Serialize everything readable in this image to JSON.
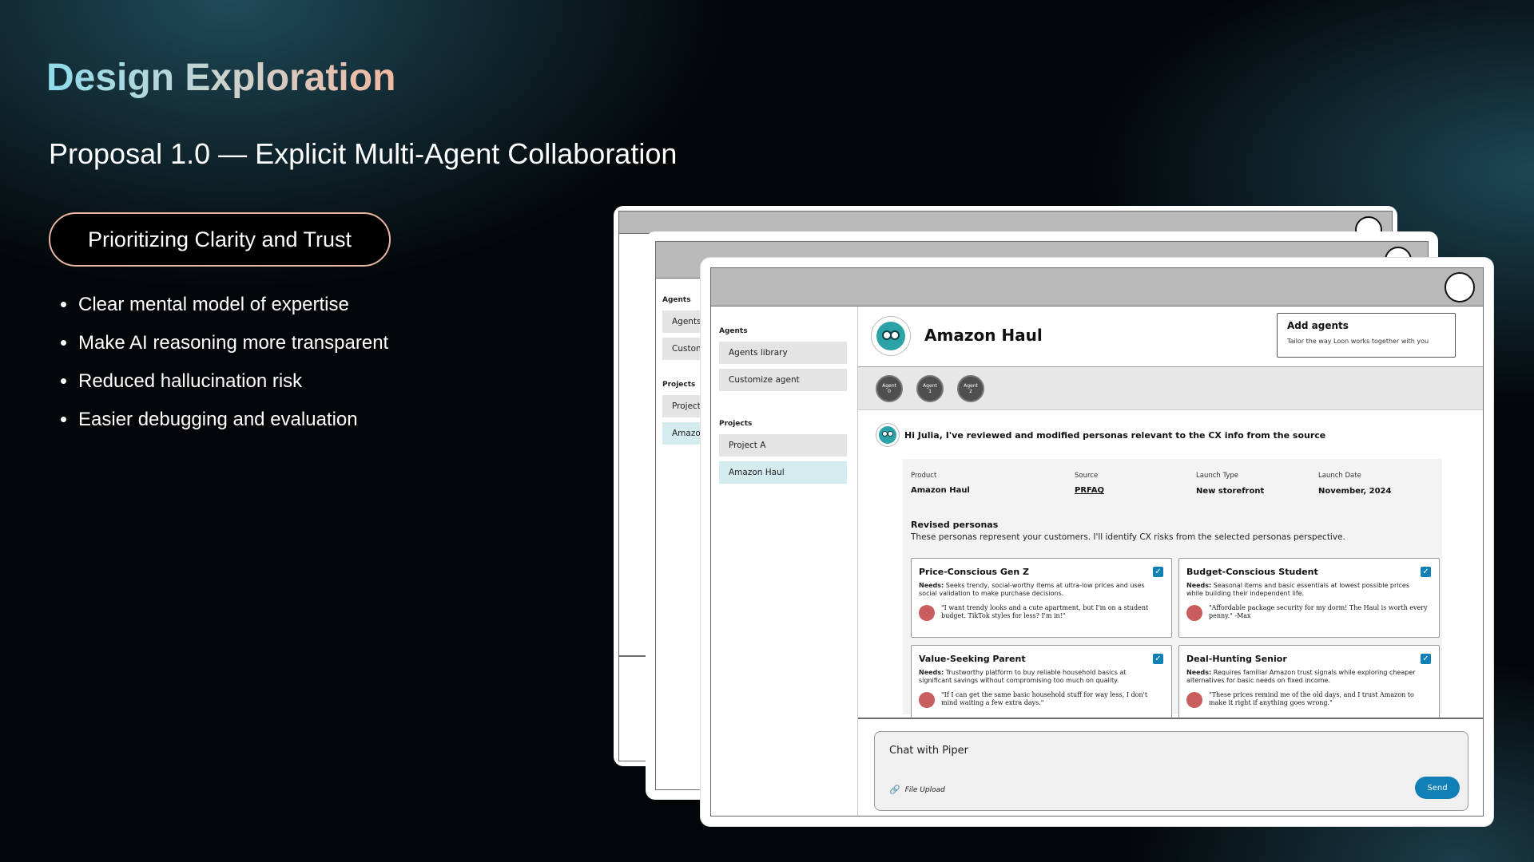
{
  "slide": {
    "title": "Design Exploration",
    "subtitle": "Proposal 1.0 — Explicit Multi-Agent Collaboration",
    "pill": "Prioritizing Clarity and Trust",
    "bullets": [
      "Clear mental model of expertise",
      "Make AI reasoning more transparent",
      "Reduced hallucination risk",
      "Easier debugging and evaluation"
    ],
    "colors": {
      "title_gradient": [
        "#8fdcec",
        "#f3b7a0"
      ],
      "pill_border": "#e7b6a3",
      "accent": "#0f7fb5"
    }
  },
  "back_card_1": {
    "sidebar": {
      "agents_heading": "Agents",
      "items": [
        "Agents",
        "Custon"
      ],
      "projects_heading": "Projects",
      "projects": [
        "Project",
        "Amazo"
      ]
    }
  },
  "mockup": {
    "sidebar": {
      "agents_heading": "Agents",
      "items": [
        "Agents library",
        "Customize agent"
      ],
      "projects_heading": "Projects",
      "projects": [
        "Project A",
        "Amazon Haul"
      ]
    },
    "header": {
      "title": "Amazon Haul",
      "add_agents_title": "Add agents",
      "add_agents_desc": "Tailor the way Loon works together with you"
    },
    "agents": [
      {
        "label": "Agent",
        "num": "0"
      },
      {
        "label": "Agent",
        "num": "1"
      },
      {
        "label": "Agent",
        "num": "2"
      }
    ],
    "message": "Hi Julia, I've reviewed and modified personas relevant to the CX info from the source",
    "meta": [
      {
        "key": "Product",
        "value": "Amazon Haul"
      },
      {
        "key": "Source",
        "value": "PRFAQ"
      },
      {
        "key": "Launch Type",
        "value": "New storefront"
      },
      {
        "key": "Launch Date",
        "value": "November, 2024"
      }
    ],
    "revised_title": "Revised personas",
    "revised_desc": "These personas represent your customers. I'll identify CX risks from the selected personas perspective.",
    "personas": [
      {
        "name": "Price-Conscious Gen Z",
        "needs_label": "Needs:",
        "needs": "Seeks trendy, social-worthy items at ultra-low prices and uses social validation to make purchase decisions.",
        "quote": "\"I want trendy looks and a cute apartment, but I'm on a student budget. TikTok styles for less? I'm in!\"",
        "checked": true
      },
      {
        "name": "Budget-Conscious Student",
        "needs_label": "Needs:",
        "needs": "Seasonal items and basic essentials at lowest possible prices while building their independent life.",
        "quote": "\"Affordable package security for my dorm! The Haul is worth every penny.\" -Max",
        "checked": true
      },
      {
        "name": "Value-Seeking Parent",
        "needs_label": "Needs:",
        "needs": "Trustworthy platform to buy reliable household basics at significant savings without compromising too much on quality.",
        "quote": "\"If I can get the same basic household stuff for way less, I don't mind waiting a few extra days.\"",
        "checked": true
      },
      {
        "name": "Deal-Hunting Senior",
        "needs_label": "Needs:",
        "needs": "Requires familiar Amazon trust signals while exploring cheaper alternatives for basic needs on fixed income.",
        "quote": "\"These prices remind me of the old days, and I trust Amazon to make it right if anything goes wrong.\"",
        "checked": true
      }
    ],
    "chat": {
      "placeholder": "Chat with Piper",
      "upload": "File Upload",
      "send": "Send"
    }
  }
}
